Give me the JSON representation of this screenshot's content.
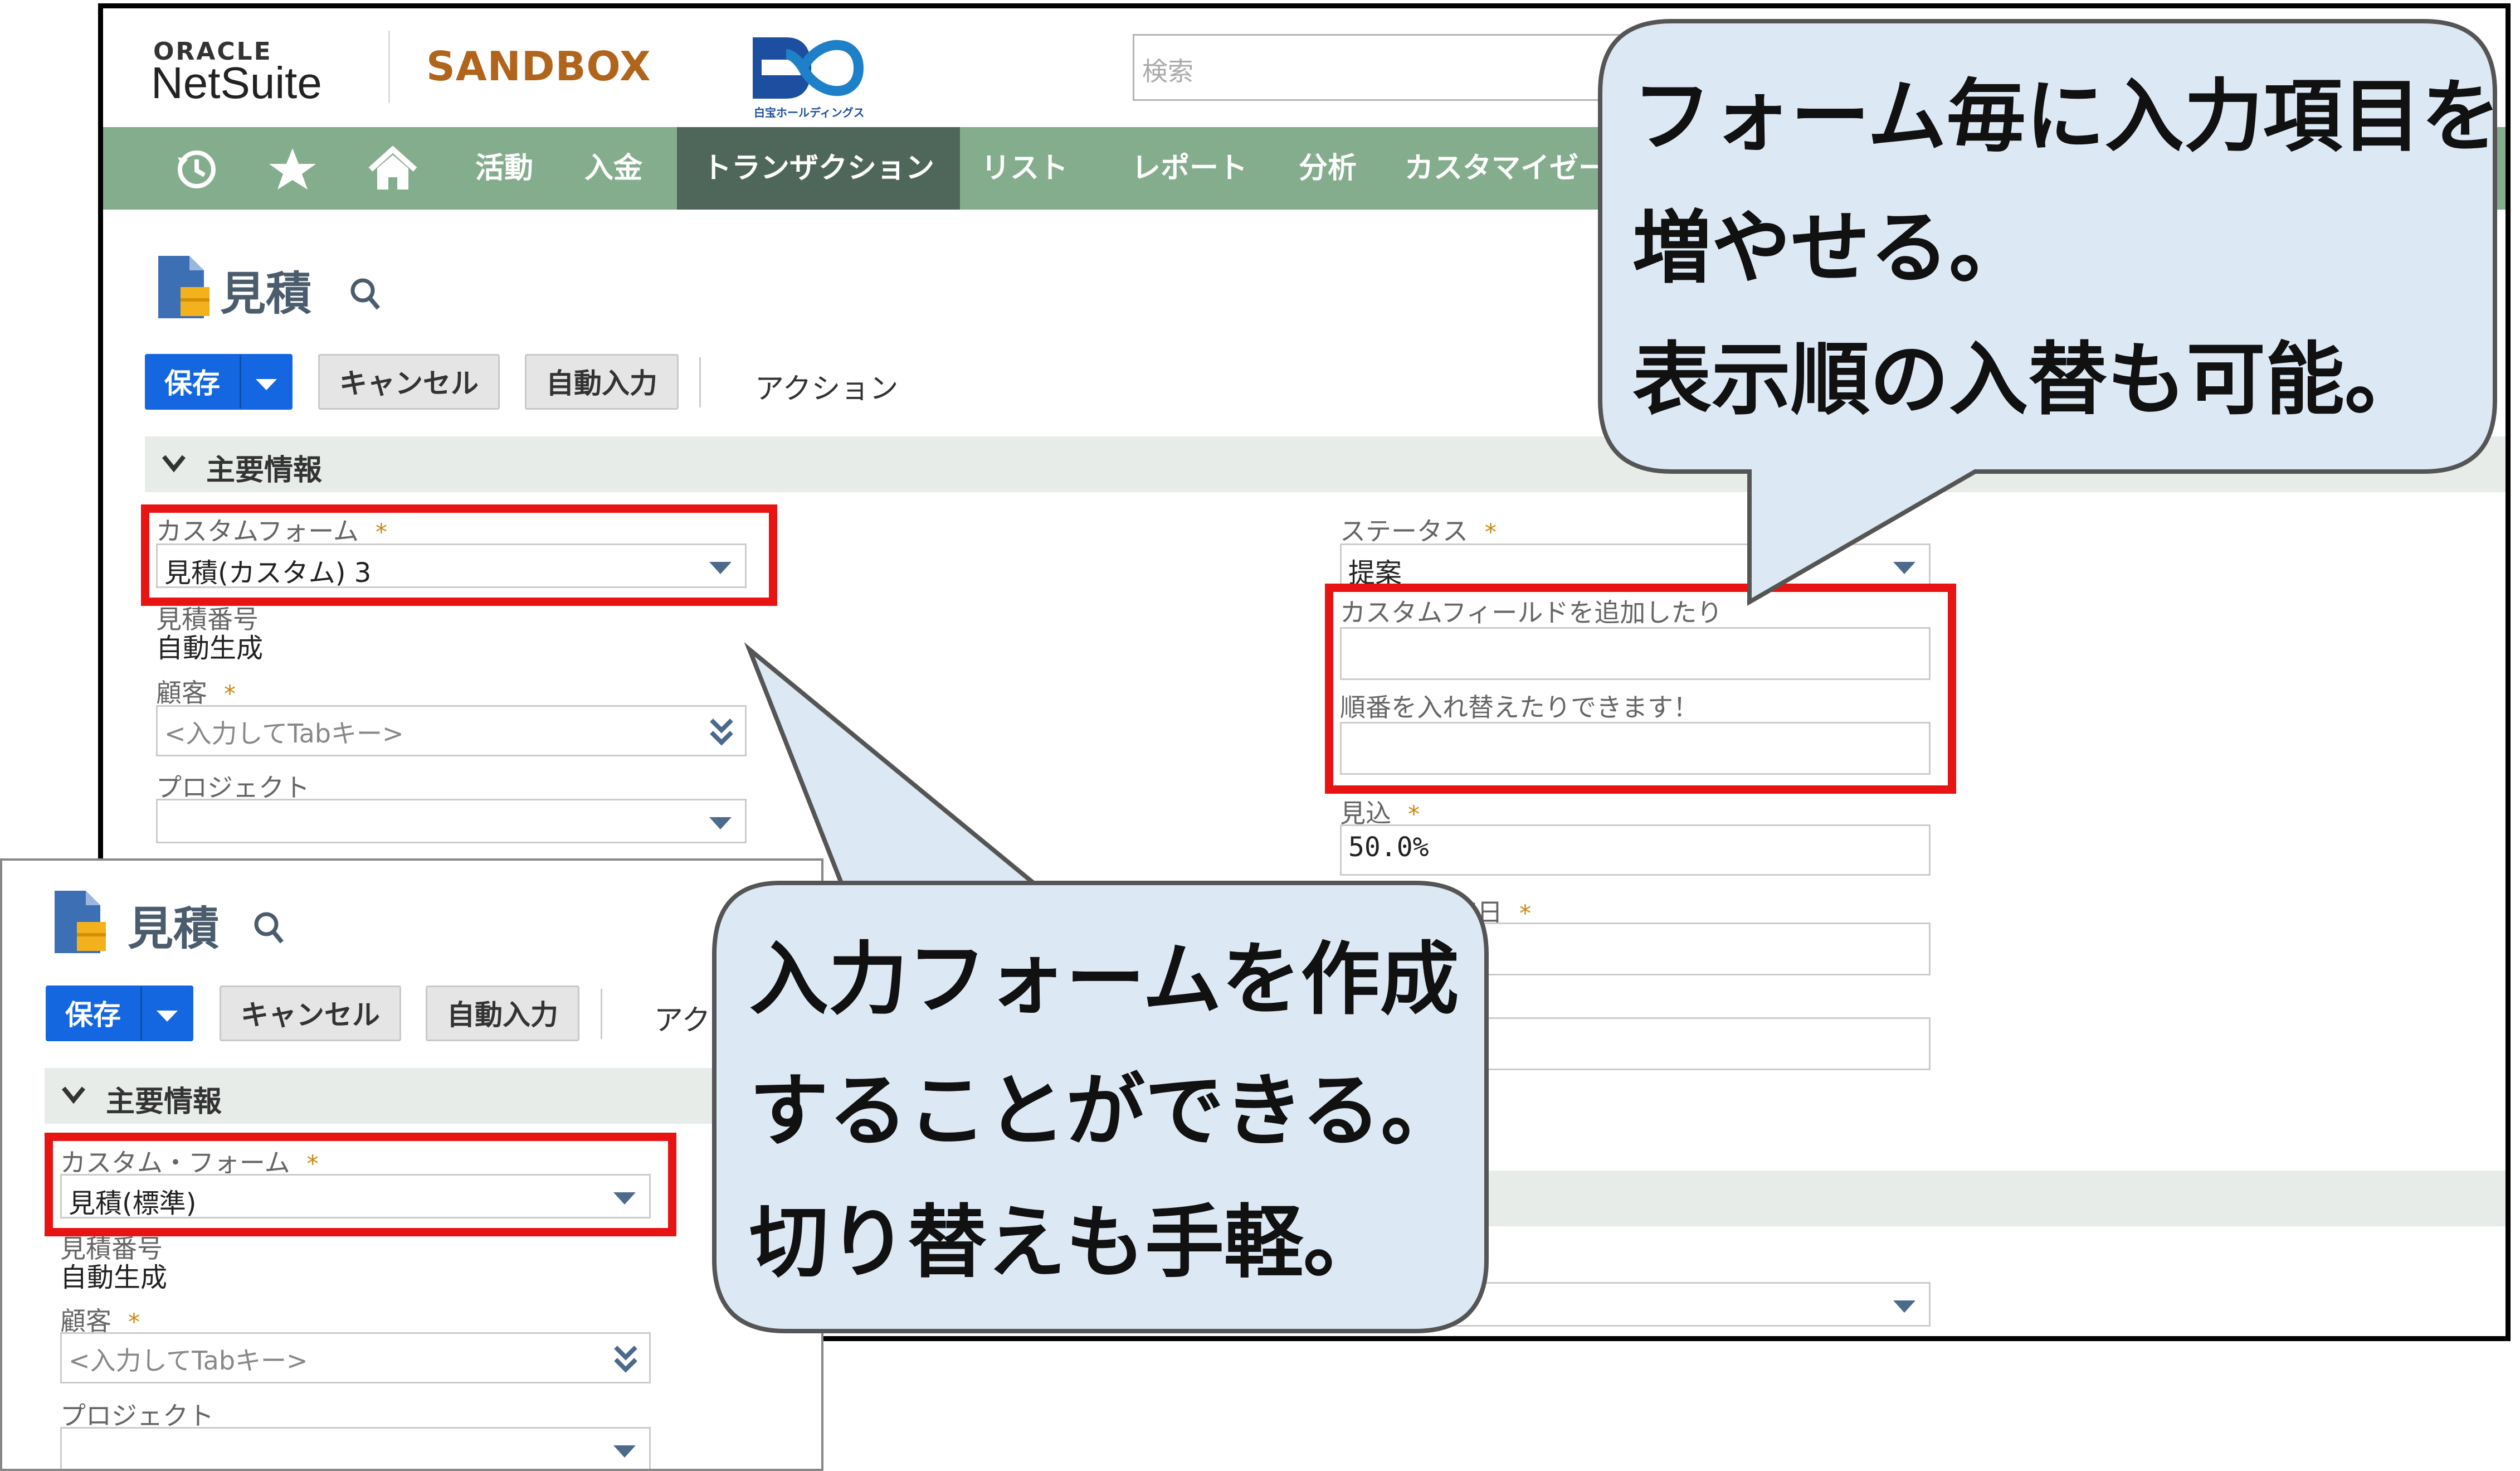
{
  "brand": {
    "oracle": "ORACLE",
    "netsuite": "NetSuite",
    "sandbox": "SANDBOX",
    "company_sub": "白宝ホールディングス"
  },
  "search": {
    "placeholder": "検索"
  },
  "nav": {
    "icons": [
      "clock-icon",
      "star-icon",
      "home-icon"
    ],
    "items": [
      "活動",
      "入金",
      "トランザクション",
      "リスト",
      "レポート",
      "分析",
      "カスタマイゼー"
    ],
    "active_index": 2
  },
  "page": {
    "title": "見積",
    "buttons": {
      "save": "保存",
      "cancel": "キャンセル",
      "autofill": "自動入力",
      "action": "アクション"
    },
    "section": "主要情報"
  },
  "main_form": {
    "custom_form": {
      "label": "カスタムフォーム",
      "value": "見積(カスタム) 3"
    },
    "estimate_number": {
      "label": "見積番号",
      "value": "自動生成"
    },
    "customer": {
      "label": "顧客",
      "placeholder": "<入力してTabキー>"
    },
    "project": {
      "label": "プロジェクト",
      "value": ""
    },
    "status": {
      "label": "ステータス",
      "value": "提案"
    },
    "custom_field_1": {
      "label": "カスタムフィールドを追加したり",
      "value": ""
    },
    "custom_field_2": {
      "label": "順番を入れ替えたりできます！",
      "value": ""
    },
    "probability": {
      "label": "見込",
      "value": "50.0%"
    },
    "close_date": {
      "label": "定日",
      "value": ""
    }
  },
  "overlay_form": {
    "title": "見積",
    "buttons": {
      "save": "保存",
      "cancel": "キャンセル",
      "autofill": "自動入力",
      "action": "アク"
    },
    "section": "主要情報",
    "custom_form": {
      "label": "カスタム・フォーム",
      "value": "見積(標準)"
    },
    "estimate_number": {
      "label": "見積番号",
      "value": "自動生成"
    },
    "customer": {
      "label": "顧客",
      "placeholder": "<入力してTabキー>"
    },
    "project": {
      "label": "プロジェクト"
    }
  },
  "callouts": {
    "top_right": [
      "フォーム毎に入力項目を",
      "増やせる。",
      "表示順の入替も可能。"
    ],
    "bottom": [
      "入力フォームを作成",
      "することができる。",
      "切り替えも手軽。"
    ]
  },
  "colors": {
    "nav_bg": "#84ad8d",
    "nav_active": "#4f675b",
    "primary_button": "#1467e0",
    "highlight_red": "#e81414",
    "callout_fill": "#dde8f5",
    "required_star": "#c98a14"
  }
}
